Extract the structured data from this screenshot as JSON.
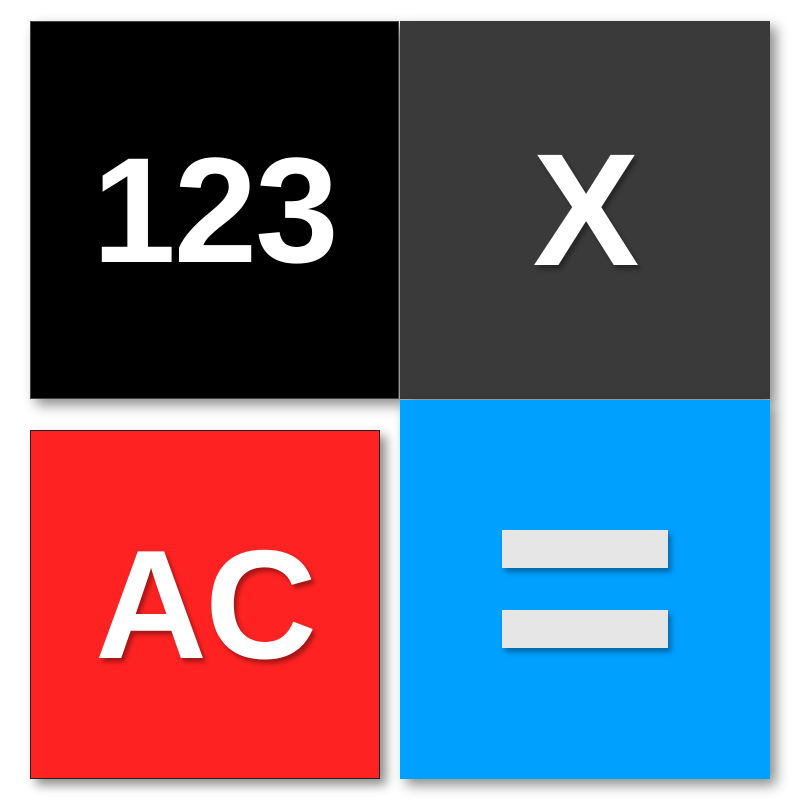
{
  "keys": {
    "digits": {
      "label": "123",
      "color": "#000000"
    },
    "times": {
      "label": "X",
      "color": "#3a3a3a"
    },
    "clear": {
      "label": "AC",
      "color": "#fe2222"
    },
    "equals": {
      "icon": "equals-icon",
      "color": "#00a0ff",
      "bar_color": "#e6e6e6"
    }
  }
}
